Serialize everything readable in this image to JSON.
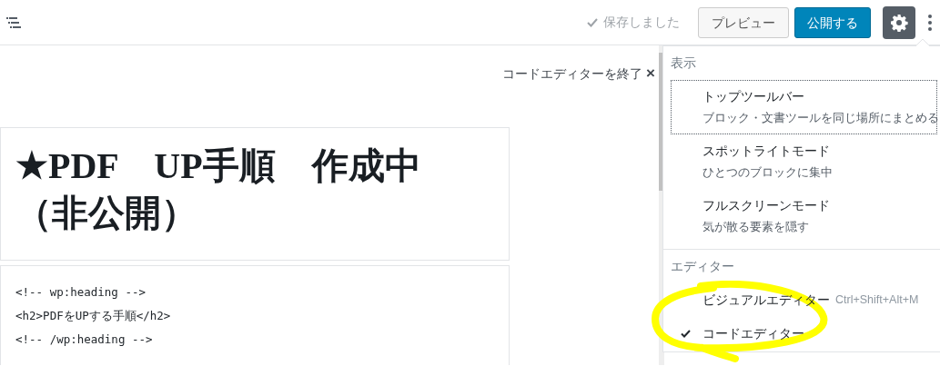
{
  "toolbar": {
    "saved_status": "保存しました",
    "preview_button": "プレビュー",
    "publish_button": "公開する",
    "settings_active": true
  },
  "editor": {
    "exit_code_editor": "コードエディターを終了",
    "exit_icon": "×",
    "title": "★PDF　UP手順　作成中（非公開）",
    "code_lines": [
      "<!-- wp:heading -->",
      "<h2>PDFをUPする手順</h2>",
      "<!-- /wp:heading -->"
    ]
  },
  "menu": {
    "sections": [
      {
        "label": "表示",
        "items": [
          {
            "label": "トップツールバー",
            "description": "ブロック・文書ツールを同じ場所にまとめる",
            "focused": true,
            "selected": false
          },
          {
            "label": "スポットライトモード",
            "description": "ひとつのブロックに集中",
            "focused": false,
            "selected": false
          },
          {
            "label": "フルスクリーンモード",
            "description": "気が散る要素を隠す",
            "focused": false,
            "selected": false
          }
        ]
      },
      {
        "label": "エディター",
        "items": [
          {
            "label": "ビジュアルエディター",
            "shortcut": "Ctrl+Shift+Alt+M",
            "focused": false,
            "selected": false
          },
          {
            "label": "コードエディター",
            "focused": false,
            "selected": true
          }
        ]
      }
    ]
  }
}
